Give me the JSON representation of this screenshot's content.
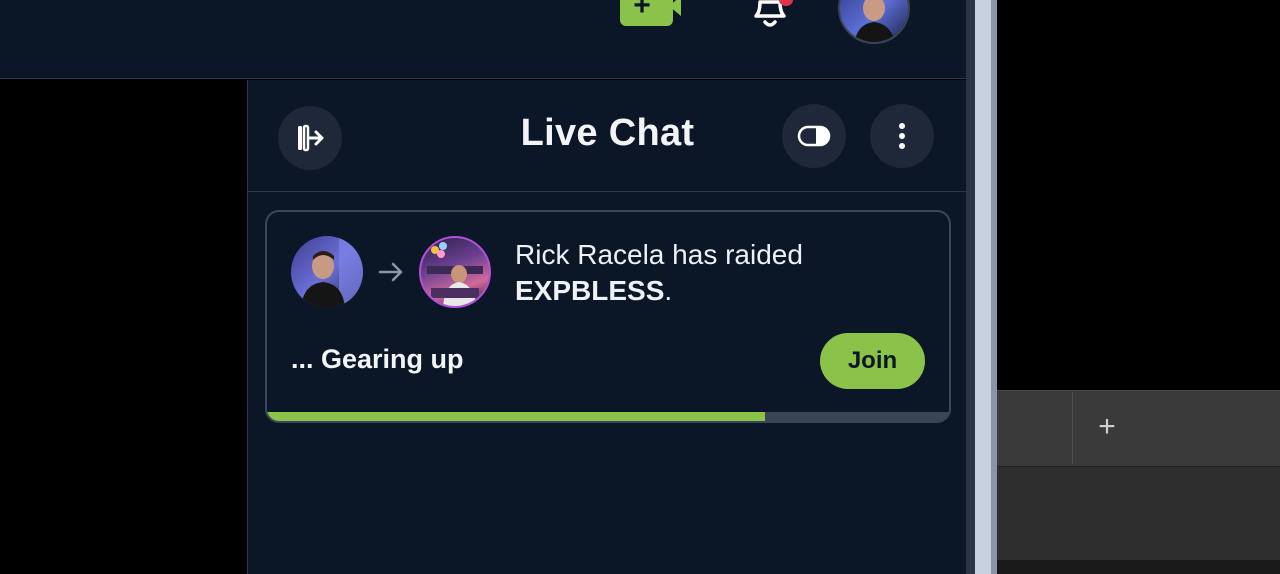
{
  "topbar": {
    "create_icon": "video-plus-icon",
    "notifications_icon": "bell-icon",
    "avatar_icon": "user-avatar"
  },
  "chat": {
    "title": "Live Chat",
    "exit_icon": "exit-chat-icon",
    "theater_icon": "theater-mode-icon",
    "more_icon": "vertical-dots-icon"
  },
  "raid": {
    "raider_name": "Rick Racela",
    "action_text": "has raided",
    "target_channel": "EXPBLESS",
    "punctuation": ".",
    "status_text": "... Gearing up",
    "join_label": "Join",
    "progress": 0.73,
    "arrow_icon": "arrow-right-icon"
  },
  "browser": {
    "new_tab_label": "+"
  },
  "colors": {
    "accent_green": "#8bc34a",
    "panel_bg": "#0b1626",
    "notification_red": "#e0344a"
  }
}
